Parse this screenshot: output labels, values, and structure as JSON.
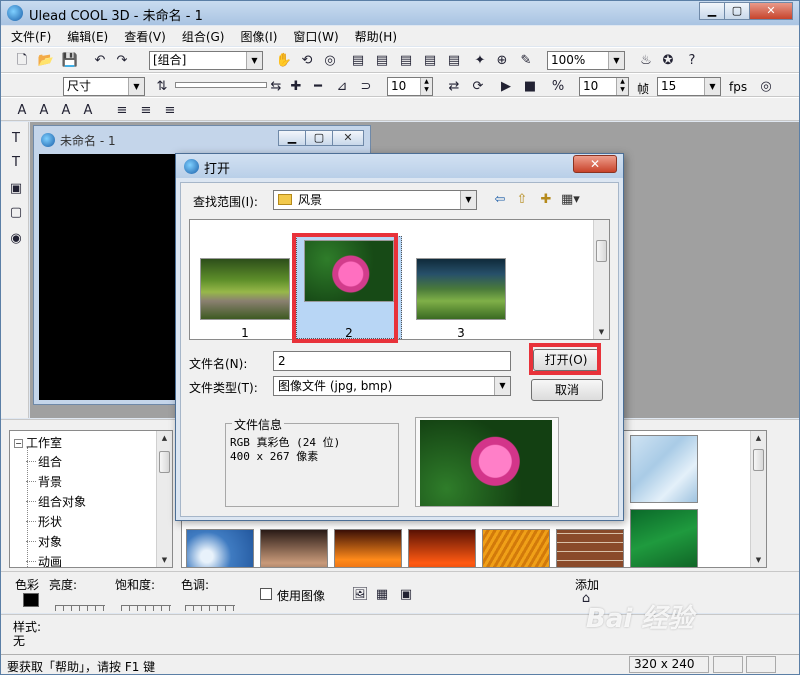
{
  "window": {
    "title": "Ulead COOL 3D - 未命名 - 1"
  },
  "menu": [
    "文件(F)",
    "编辑(E)",
    "查看(V)",
    "组合(G)",
    "图像(I)",
    "窗口(W)",
    "帮助(H)"
  ],
  "toolbar1": {
    "group_combo": "[组合]",
    "zoom_combo": "100%"
  },
  "toolbar2": {
    "size_combo": "尺寸",
    "field1": "10",
    "field2": "10",
    "field3": "15",
    "frame_label": "帧",
    "fps_label": "fps"
  },
  "document": {
    "title": "未命名 - 1"
  },
  "tree": {
    "root": "工作室",
    "items": [
      "组合",
      "背景",
      "组合对象",
      "形状",
      "对象",
      "动画"
    ]
  },
  "props": {
    "color": "色彩",
    "brightness": "亮度:",
    "saturation": "饱和度:",
    "hue": "色调:",
    "use_image": "使用图像",
    "add": "添加"
  },
  "style": {
    "label": "样式:",
    "value": "无"
  },
  "status": {
    "message": "要获取「帮助」，请按 F1 键",
    "size": "320 x 240"
  },
  "dialog": {
    "title": "打开",
    "lookin_label": "查找范围(I):",
    "lookin_value": "风景",
    "files": [
      {
        "caption": "1",
        "image": "tree-lined road"
      },
      {
        "caption": "2",
        "image": "pink lotus flower"
      },
      {
        "caption": "3",
        "image": "green hills at dusk"
      }
    ],
    "filename_label": "文件名(N):",
    "filename_value": "2",
    "filetype_label": "文件类型(T):",
    "filetype_value": "图像文件 (jpg, bmp)",
    "open_button": "打开(O)",
    "cancel_button": "取消",
    "info_legend": "文件信息",
    "info_line1": "RGB 真彩色 (24 位)",
    "info_line2": "400 x 267 像素"
  },
  "colors": {
    "highlight": "#e8323a",
    "selection": "#b8d6f5"
  },
  "watermark": "Bai 经验"
}
